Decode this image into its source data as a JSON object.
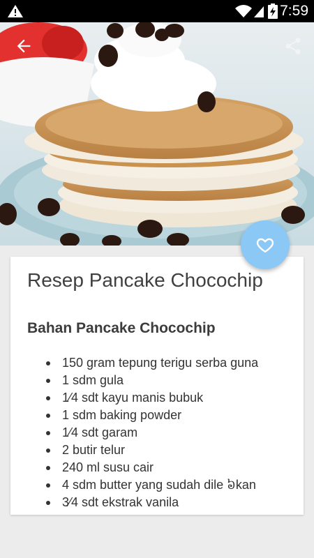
{
  "status_bar": {
    "time": "7:59",
    "icons": [
      "warning-icon",
      "wifi-icon",
      "signal-icon",
      "battery-charging-icon"
    ]
  },
  "toolbar": {
    "back_icon": "arrow-back-icon",
    "share_icon": "share-icon"
  },
  "hero": {
    "image_subject": "pancake-stack-photo"
  },
  "fab": {
    "icon": "heart-outline-icon",
    "color": "#8cc8f5"
  },
  "recipe": {
    "title": "Resep Pancake Chocochip",
    "section_title": "Bahan Pancake Chocochip",
    "ingredients": [
      "150 gram tepung terigu serba guna",
      "1 sdm gula",
      "1⁄4 sdt kayu manis bubuk",
      "1 sdm baking powder",
      "1⁄4  sdt garam",
      "2 butir telur",
      "240 ml susu cair",
      "4 sdm butter yang sudah dile    ៦kan",
      "3⁄4 sdt ekstrak vanila"
    ]
  }
}
